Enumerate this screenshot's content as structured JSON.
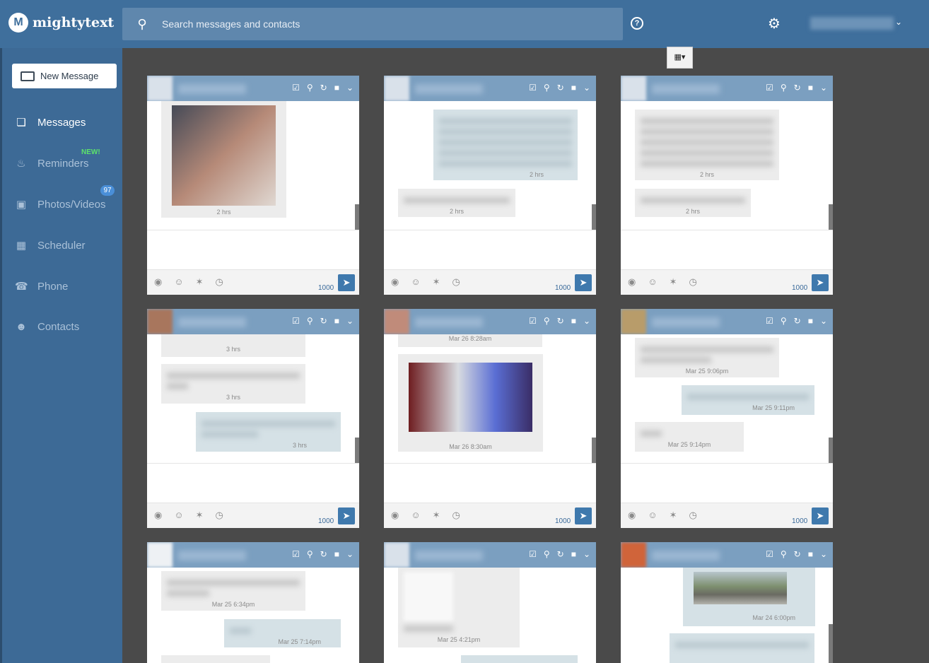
{
  "app": {
    "name": "mightytext",
    "logo_letter": "M"
  },
  "search": {
    "placeholder": "Search messages and contacts"
  },
  "sidebar": {
    "new_message_label": "New Message",
    "items": [
      {
        "label": "Messages",
        "icon": "messages-icon",
        "active": true
      },
      {
        "label": "Reminders",
        "icon": "bell-icon",
        "badge": "NEW!"
      },
      {
        "label": "Photos/Videos",
        "icon": "photo-icon",
        "badge": "97"
      },
      {
        "label": "Scheduler",
        "icon": "calendar-icon"
      },
      {
        "label": "Phone",
        "icon": "phone-icon"
      },
      {
        "label": "Contacts",
        "icon": "contacts-icon"
      }
    ]
  },
  "toolbar": {
    "view_toggle_icon": "grid-icon"
  },
  "cards": [
    {
      "timestamps": [
        "2 hrs"
      ],
      "char_count": "1000"
    },
    {
      "timestamps": [
        "2 hrs",
        "2 hrs"
      ],
      "char_count": "1000"
    },
    {
      "timestamps": [
        "2 hrs",
        "2 hrs"
      ],
      "char_count": "1000"
    },
    {
      "timestamps": [
        "3 hrs",
        "3 hrs",
        "3 hrs"
      ],
      "char_count": "1000"
    },
    {
      "timestamps": [
        "Mar 26 8:28am",
        "Mar 26 8:30am"
      ],
      "char_count": "1000"
    },
    {
      "timestamps": [
        "Mar 25 9:06pm",
        "Mar 25 9:11pm",
        "Mar 25 9:14pm"
      ],
      "char_count": "1000"
    },
    {
      "timestamps": [
        "Mar 25 6:34pm",
        "Mar 25 7:14pm"
      ],
      "char_count": ""
    },
    {
      "timestamps": [
        "Mar 25 4:21pm"
      ],
      "char_count": ""
    },
    {
      "timestamps": [
        "Mar 24 6:00pm"
      ],
      "char_count": ""
    }
  ]
}
